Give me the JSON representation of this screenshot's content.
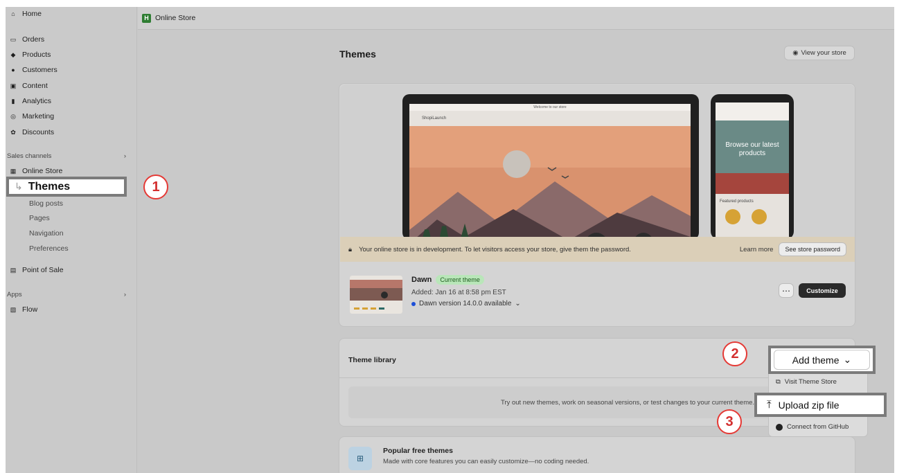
{
  "sidebar": {
    "nav": [
      {
        "label": "Home",
        "icon": "home-icon"
      },
      {
        "label": "Orders",
        "icon": "orders-icon"
      },
      {
        "label": "Products",
        "icon": "tag-icon"
      },
      {
        "label": "Customers",
        "icon": "person-icon"
      },
      {
        "label": "Content",
        "icon": "content-icon"
      },
      {
        "label": "Analytics",
        "icon": "bar-chart-icon"
      },
      {
        "label": "Marketing",
        "icon": "target-icon"
      },
      {
        "label": "Discounts",
        "icon": "discount-icon"
      }
    ],
    "sales_channels_label": "Sales channels",
    "online_store_label": "Online Store",
    "themes_label": "Themes",
    "online_store_sub": [
      "Blog posts",
      "Pages",
      "Navigation",
      "Preferences"
    ],
    "pos_label": "Point of Sale",
    "apps_label": "Apps",
    "flow_label": "Flow"
  },
  "topbar": {
    "title": "Online Store"
  },
  "page": {
    "title": "Themes",
    "view_store": "View your store"
  },
  "preview": {
    "laptop_brand": "ShopiLaunch",
    "laptop_announce": "Welcome to our store",
    "phone_headline": "Browse our latest products",
    "phone_featured": "Featured products"
  },
  "banner": {
    "message": "Your online store is in development. To let visitors access your store, give them the password.",
    "learn_more": "Learn more",
    "password_button": "See store password"
  },
  "current_theme": {
    "name": "Dawn",
    "badge": "Current theme",
    "added": "Added: Jan 16 at 8:58 pm EST",
    "version": "Dawn version 14.0.0 available",
    "more_button": "⋯",
    "customize_button": "Customize"
  },
  "library": {
    "title": "Theme library",
    "empty_text": "Try out new themes, work on seasonal versions, or test changes to your current theme.",
    "add_theme": "Add theme",
    "menu": {
      "visit_store": "Visit Theme Store",
      "upload_zip": "Upload zip file",
      "connect_github": "Connect from GitHub"
    }
  },
  "popular": {
    "title": "Popular free themes",
    "description": "Made with core features you can easily customize—no coding needed."
  },
  "annotations": {
    "one": "1",
    "two": "2",
    "three": "3"
  },
  "colors": {
    "badge_red": "#e53935",
    "current_theme_green": "#b9e6b9",
    "banner": "#dbcfb8"
  }
}
